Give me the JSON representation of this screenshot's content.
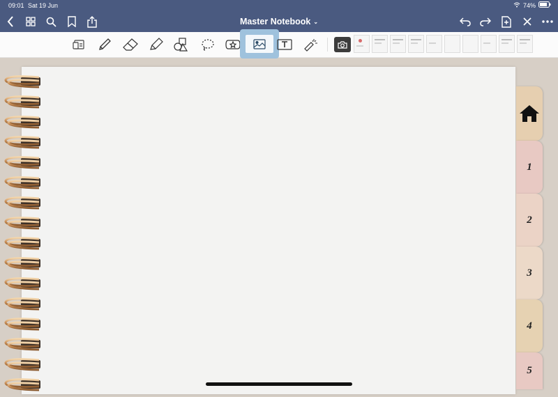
{
  "status_bar": {
    "time": "09:01",
    "date": "Sat 19 Jun",
    "battery": "74%"
  },
  "nav": {
    "title": "Master Notebook",
    "icons": [
      "back-icon",
      "grid-icon",
      "search-icon",
      "bookmark-icon",
      "share-icon",
      "undo-icon",
      "redo-icon",
      "add-page-icon",
      "close-icon",
      "more-icon"
    ]
  },
  "toolbar": {
    "tools": [
      "read-mode-icon",
      "pen-icon",
      "eraser-icon",
      "highlighter-icon",
      "shapes-icon",
      "lasso-icon",
      "sticker-icon",
      "image-icon",
      "text-icon",
      "laser-pointer-icon"
    ],
    "active_tool": "image-icon",
    "thumbnails": 10
  },
  "tabs": [
    {
      "label": "",
      "icon": "home-icon",
      "color": "#e6cfb0"
    },
    {
      "label": "1",
      "color": "#e8c9c3"
    },
    {
      "label": "2",
      "color": "#ebd3c6"
    },
    {
      "label": "3",
      "color": "#ecd9c8"
    },
    {
      "label": "4",
      "color": "#e6d2b2"
    },
    {
      "label": "5",
      "color": "#e8c9c3"
    }
  ],
  "colors": {
    "nav": "#4a5a80",
    "active_tool": "#9fc2dd",
    "background": "#d7cfc6",
    "paper": "#f3f3f2"
  }
}
